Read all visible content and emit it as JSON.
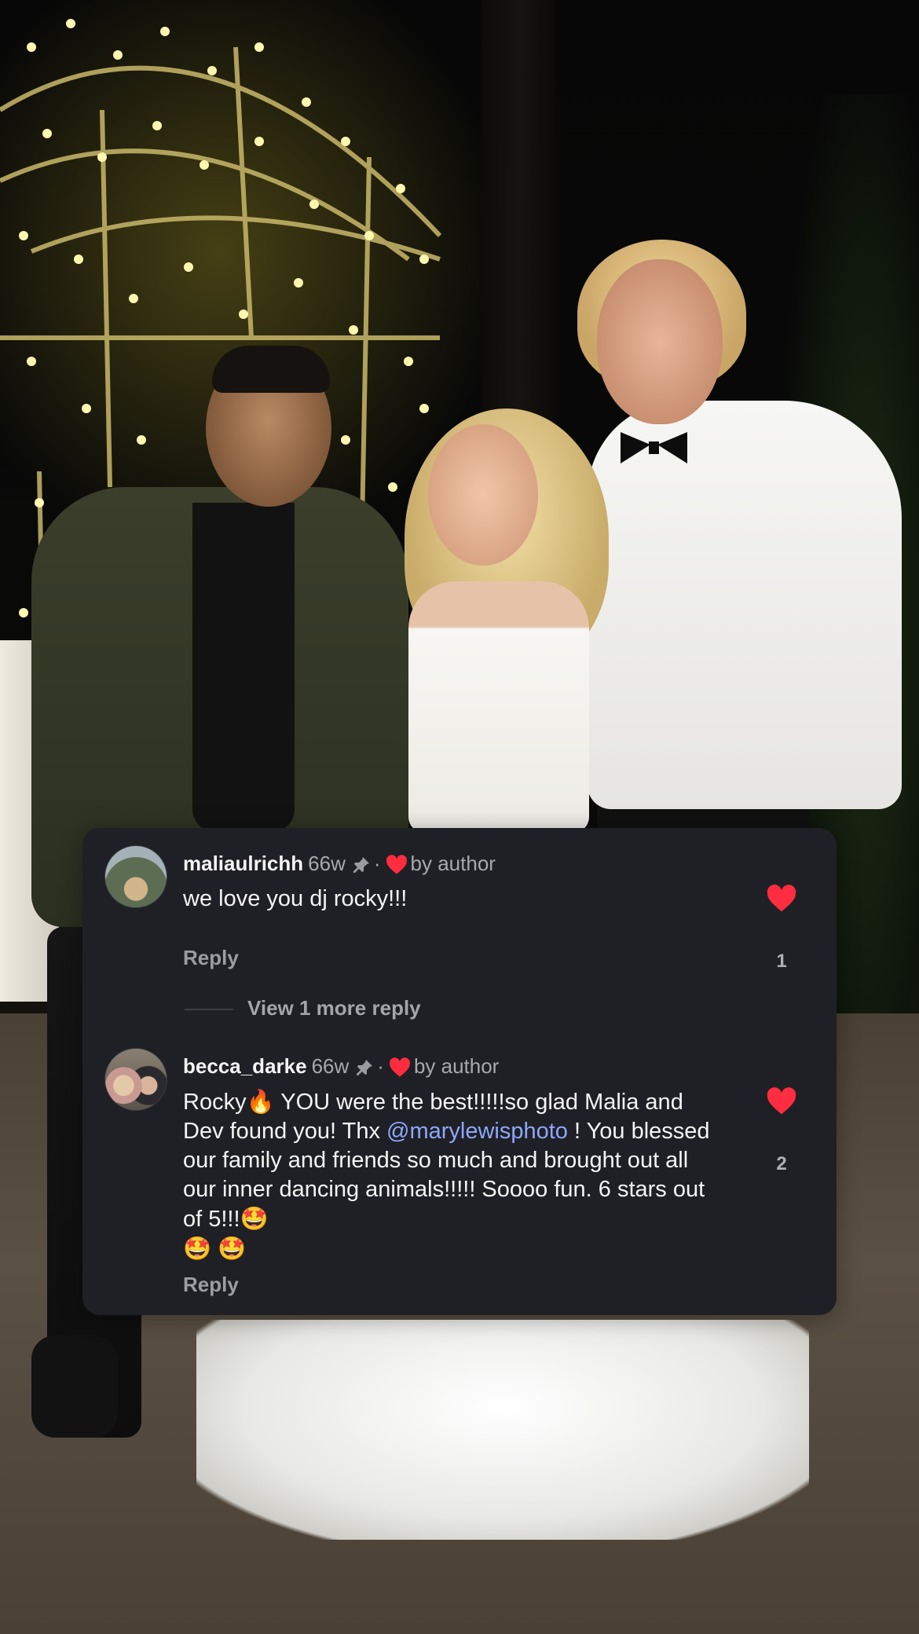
{
  "comments": [
    {
      "username": "maliaulrichh",
      "age": "66w",
      "author_badge": "by author",
      "text": "we love you dj rocky!!!",
      "reply_label": "Reply",
      "like_count": "1",
      "view_more": "View 1 more reply",
      "icons": [
        "pin-icon",
        "heart-icon"
      ]
    },
    {
      "username": "becca_darke",
      "age": "66w",
      "author_badge": "by author",
      "text_parts": {
        "p1": "Rocky",
        "e1": "🔥",
        "p2": " YOU were the best!!!!!so glad Malia and Dev found you! Thx ",
        "mention": "@marylewisphoto",
        "p3": " ! You blessed our family and friends so much and brought out all our inner dancing animals!!!!! Soooo fun.  6 stars out of 5!!!",
        "e2": "🤩",
        "e3": "🤩",
        "e4": "🤩"
      },
      "reply_label": "Reply",
      "like_count": "2"
    }
  ],
  "colors": {
    "card_bg": "#1f2025",
    "heart": "#ff2d3f",
    "mention": "#8ea7ff",
    "muted": "#a8a9ad"
  }
}
